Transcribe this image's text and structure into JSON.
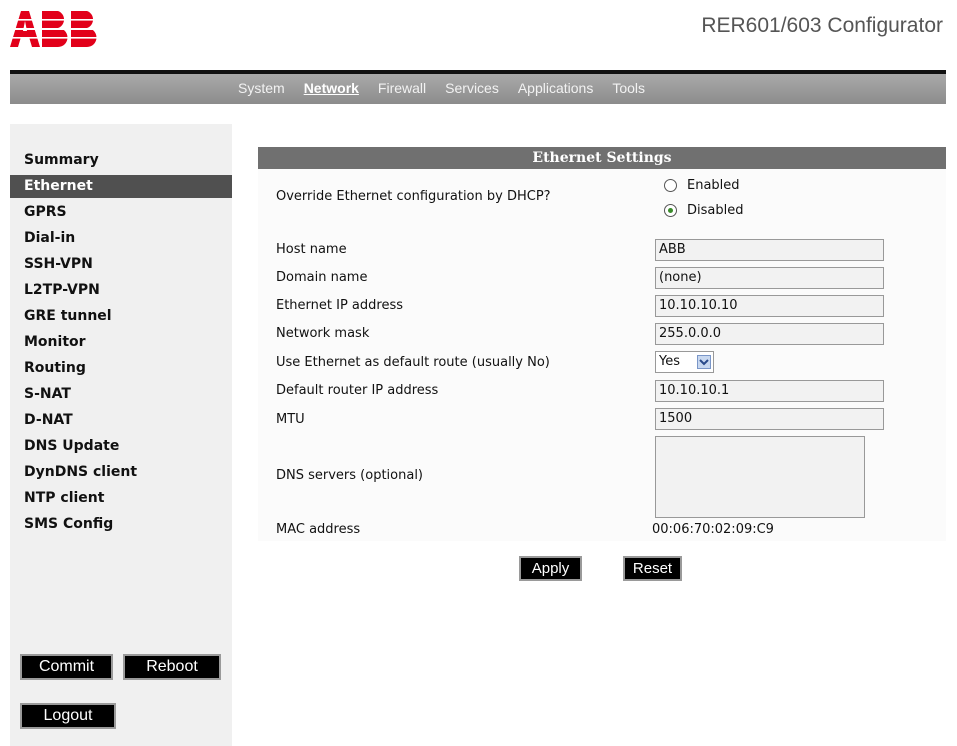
{
  "header": {
    "logo": "ABB",
    "title": "RER601/603 Configurator"
  },
  "topnav": {
    "items": [
      {
        "label": "System",
        "active": false
      },
      {
        "label": "Network",
        "active": true
      },
      {
        "label": "Firewall",
        "active": false
      },
      {
        "label": "Services",
        "active": false
      },
      {
        "label": "Applications",
        "active": false
      },
      {
        "label": "Tools",
        "active": false
      }
    ]
  },
  "sidebar": {
    "items": [
      {
        "label": "Summary"
      },
      {
        "label": "Ethernet",
        "active": true
      },
      {
        "label": "GPRS"
      },
      {
        "label": "Dial-in"
      },
      {
        "label": "SSH-VPN"
      },
      {
        "label": "L2TP-VPN"
      },
      {
        "label": "GRE tunnel"
      },
      {
        "label": "Monitor"
      },
      {
        "label": "Routing"
      },
      {
        "label": "S-NAT"
      },
      {
        "label": "D-NAT"
      },
      {
        "label": "DNS Update"
      },
      {
        "label": "DynDNS client"
      },
      {
        "label": "NTP client"
      },
      {
        "label": "SMS Config"
      }
    ],
    "commit_label": "Commit",
    "reboot_label": "Reboot",
    "logout_label": "Logout"
  },
  "panel": {
    "title": "Ethernet Settings",
    "dhcp_label": "Override Ethernet configuration by DHCP?",
    "dhcp_options": {
      "enabled": "Enabled",
      "disabled": "Disabled"
    },
    "dhcp_selected": "Disabled",
    "host_label": "Host name",
    "host_value": "ABB",
    "domain_label": "Domain name",
    "domain_value": "(none)",
    "ip_label": "Ethernet IP address",
    "ip_value": "10.10.10.10",
    "mask_label": "Network mask",
    "mask_value": "255.0.0.0",
    "default_route_label": "Use Ethernet as default route (usually No)",
    "default_route_value": "Yes",
    "router_label": "Default router IP address",
    "router_value": "10.10.10.1",
    "mtu_label": "MTU",
    "mtu_value": "1500",
    "dns_label": "DNS servers (optional)",
    "dns_value": "",
    "mac_label": "MAC address",
    "mac_value": "00:06:70:02:09:C9",
    "apply_label": "Apply",
    "reset_label": "Reset"
  },
  "colors": {
    "brand_red": "#e2001a",
    "nav_bar": "#999999",
    "sidebar_active": "#505050",
    "panel_header": "#707070"
  }
}
